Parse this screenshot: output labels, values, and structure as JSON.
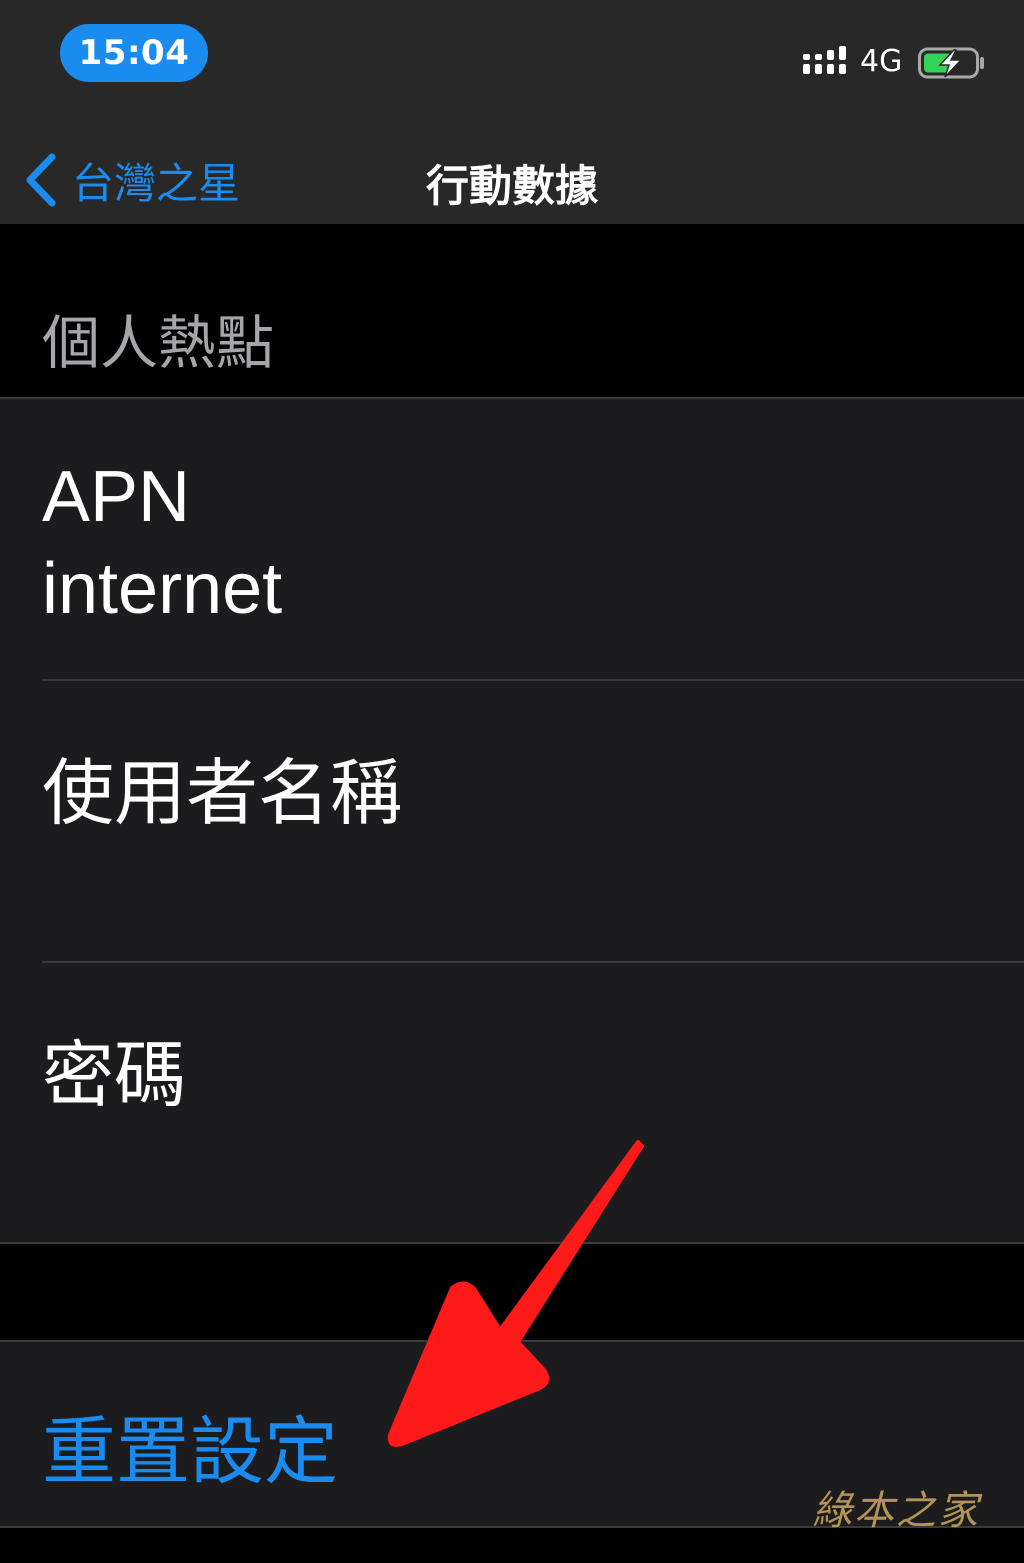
{
  "status_bar": {
    "time": "15:04",
    "network": "4G",
    "battery_state": "charging",
    "accent_color": "#1a8cf0",
    "battery_bolt_color": "#33d35a",
    "icons": [
      "signal-icon",
      "battery-charging-icon"
    ]
  },
  "nav": {
    "back_label": "台灣之星",
    "title": "行動數據",
    "back_icon": "chevron-left-icon"
  },
  "section": {
    "header": "個人熱點"
  },
  "fields": {
    "apn_label": "APN",
    "apn_value": "internet",
    "username_label": "使用者名稱",
    "password_label": "密碼"
  },
  "reset": {
    "label": "重置設定"
  },
  "annotation": {
    "arrow_color": "#ff1a1a",
    "watermark": "綠本之家"
  }
}
